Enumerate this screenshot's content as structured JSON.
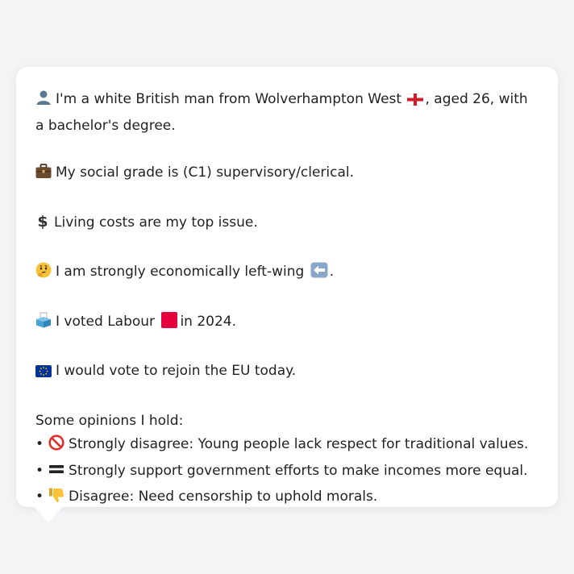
{
  "profile": {
    "intro_a": "I'm a white British man from Wolverhampton West",
    "intro_b": ", aged 26, with a bachelor's degree.",
    "social_grade": "My social grade is (C1) supervisory/clerical.",
    "top_issue": "Living costs are my top issue.",
    "economic_a": "I am strongly economically left-wing",
    "economic_b": ".",
    "vote_a": "I voted Labour",
    "vote_b": "in 2024.",
    "eu": "I would vote to rejoin the EU today."
  },
  "opinions": {
    "heading": "Some opinions I hold:",
    "bullet": "•",
    "items": [
      {
        "icon": "prohibited-icon",
        "text": "Strongly disagree: Young people lack respect for traditional values."
      },
      {
        "icon": "equals-icon",
        "text": "Strongly support government efforts to make incomes more equal."
      },
      {
        "icon": "thumbs-down-icon",
        "text": "Disagree: Need censorship to uphold morals."
      }
    ]
  },
  "colors": {
    "labour_red": "#e4003b",
    "eu_blue": "#003399",
    "flag_red": "#cf1b2b",
    "left_arrow_blue": "#8aa6c8"
  }
}
